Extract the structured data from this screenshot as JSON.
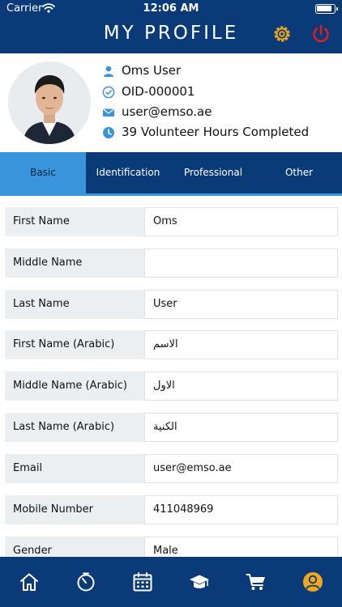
{
  "status_bar": {
    "carrier": "Carrier",
    "time": "12:06 AM"
  },
  "header": {
    "title": "MY PROFILE"
  },
  "profile": {
    "name": "Oms User",
    "oid": "OID-000001",
    "email": "user@emso.ae",
    "volunteer_hours": "39 Volunteer Hours Completed"
  },
  "tabs": [
    {
      "label": "Basic",
      "active": true
    },
    {
      "label": "Identification",
      "active": false
    },
    {
      "label": "Professional",
      "active": false
    },
    {
      "label": "Other",
      "active": false
    }
  ],
  "form": {
    "fields": [
      {
        "label": "First Name",
        "value": "Oms"
      },
      {
        "label": "Middle Name",
        "value": ""
      },
      {
        "label": "Last Name",
        "value": "User"
      },
      {
        "label": "First Name (Arabic)",
        "value": "الاسم"
      },
      {
        "label": "Middle Name (Arabic)",
        "value": "الاول"
      },
      {
        "label": "Last Name (Arabic)",
        "value": "الكنية"
      },
      {
        "label": "Email",
        "value": "user@emso.ae"
      },
      {
        "label": "Mobile Number",
        "value": "411048969"
      },
      {
        "label": "Gender",
        "value": "Male"
      }
    ]
  },
  "colors": {
    "header_bg": "#0a3a78",
    "tab_active": "#3a94dc",
    "settings_icon": "#f0a81e",
    "power_icon": "#e02020",
    "profile_nav_icon": "#f0a81e",
    "info_icon": "#3a94dc"
  },
  "icons": {
    "header": [
      "gear-icon",
      "power-icon"
    ],
    "info": [
      "user-icon",
      "check-circle-icon",
      "envelope-icon",
      "clock-icon"
    ],
    "bottom_nav": [
      "home-icon",
      "timer-icon",
      "calendar-icon",
      "graduation-cap-icon",
      "cart-icon",
      "user-circle-icon"
    ]
  }
}
